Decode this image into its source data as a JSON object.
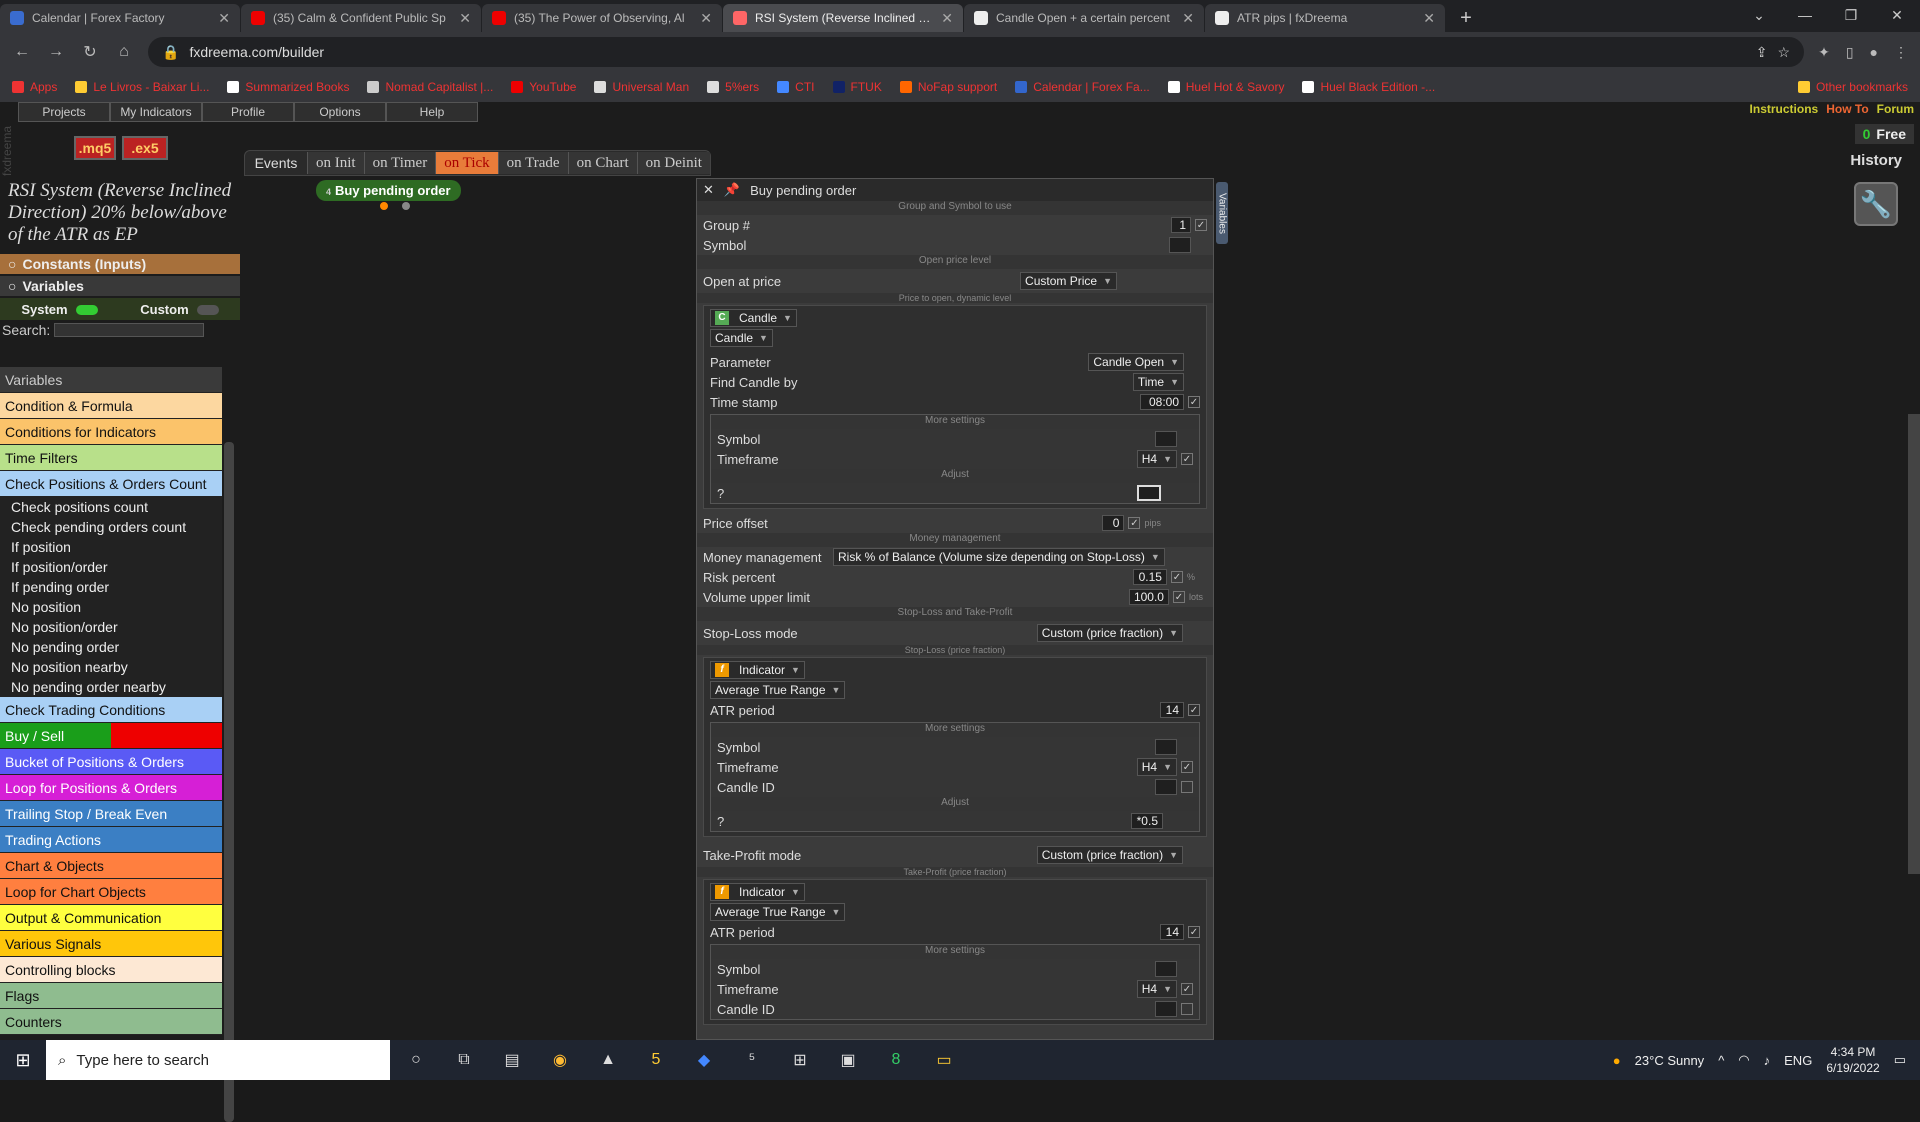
{
  "tabs": [
    {
      "title": "Calendar | Forex Factory",
      "color": "#3a6ccf",
      "active": false
    },
    {
      "title": "(35) Calm & Confident Public Sp",
      "color": "#e00",
      "active": false
    },
    {
      "title": "(35) The Power of Observing, Al",
      "color": "#e00",
      "active": false
    },
    {
      "title": "RSI System (Reverse Inclined Dir",
      "color": "#f66",
      "active": true
    },
    {
      "title": "Candle Open + a certain percent",
      "color": "#eee",
      "active": false
    },
    {
      "title": "ATR pips | fxDreema",
      "color": "#eee",
      "active": false
    }
  ],
  "address": {
    "url": "fxdreema.com/builder"
  },
  "bookmarks": [
    {
      "label": "Apps",
      "color": "#e33"
    },
    {
      "label": "Le Livros - Baixar Li...",
      "color": "#fc3"
    },
    {
      "label": "Summarized Books",
      "color": "#fff"
    },
    {
      "label": "Nomad Capitalist |...",
      "color": "#ccc"
    },
    {
      "label": "YouTube",
      "color": "#e00"
    },
    {
      "label": "Universal Man",
      "color": "#ddd"
    },
    {
      "label": "5%ers",
      "color": "#ddd"
    },
    {
      "label": "CTI",
      "color": "#48f"
    },
    {
      "label": "FTUK",
      "color": "#126"
    },
    {
      "label": "NoFap support",
      "color": "#f60"
    },
    {
      "label": "Calendar | Forex Fa...",
      "color": "#36c"
    },
    {
      "label": "Huel Hot & Savory",
      "color": "#fff"
    },
    {
      "label": "Huel Black Edition -...",
      "color": "#fff"
    }
  ],
  "other_bookmarks": "Other bookmarks",
  "app": {
    "logo_vertical": "fxdreema",
    "menu": [
      "Projects",
      "My Indicators",
      "Profile",
      "Options",
      "Help"
    ],
    "links": {
      "instructions": "Instructions",
      "howto": "How To",
      "forum": "Forum"
    },
    "free_count": "0",
    "free_label": "Free",
    "history": "History",
    "mq5": ".mq5",
    "ex5": ".ex5",
    "events_label": "Events",
    "events": [
      "on Init",
      "on Timer",
      "on Tick",
      "on Trade",
      "on Chart",
      "on Deinit"
    ],
    "active_event": 2,
    "project_title": "RSI System (Reverse Inclined Direction) 20% below/above of the ATR as EP",
    "constants": "Constants (Inputs)",
    "variables_head": "Variables",
    "system": "System",
    "custom": "Custom",
    "search_label": "Search:",
    "categories": [
      {
        "label": "Variables",
        "bg": "#3a3a3a",
        "fg": "#ccc"
      },
      {
        "label": "Condition & Formula",
        "bg": "#fcd7a0",
        "fg": "#111"
      },
      {
        "label": "Conditions for Indicators",
        "bg": "#fbc36a",
        "fg": "#111"
      },
      {
        "label": "Time Filters",
        "bg": "#b8e08a",
        "fg": "#111"
      },
      {
        "label": "Check Positions & Orders Count",
        "bg": "#a9d0f5",
        "fg": "#111"
      }
    ],
    "sub_items": [
      "Check positions count",
      "Check pending orders count",
      "If position",
      "If position/order",
      "If pending order",
      "No position",
      "No position/order",
      "No pending order",
      "No position nearby",
      "No pending order nearby"
    ],
    "categories2": [
      {
        "label": "Check Trading Conditions",
        "bg": "#a9d0f5",
        "fg": "#111"
      },
      {
        "label": "Buy / Sell",
        "bg": "#1a9e1a",
        "fg": "#fff"
      },
      {
        "label": "Bucket of Positions & Orders",
        "bg": "#5a5af5",
        "fg": "#fff"
      },
      {
        "label": "Loop for Positions & Orders",
        "bg": "#d61fd6",
        "fg": "#fff"
      },
      {
        "label": "Trailing Stop / Break Even",
        "bg": "#3b7fc4",
        "fg": "#fff"
      },
      {
        "label": "Trading Actions",
        "bg": "#3b7fc4",
        "fg": "#fff"
      },
      {
        "label": "Chart & Objects",
        "bg": "#ff7f3f",
        "fg": "#111"
      },
      {
        "label": "Loop for Chart Objects",
        "bg": "#ff7f3f",
        "fg": "#111"
      },
      {
        "label": "Output & Communication",
        "bg": "#ffff3f",
        "fg": "#111"
      },
      {
        "label": "Various Signals",
        "bg": "#ffc60a",
        "fg": "#111"
      },
      {
        "label": "Controlling blocks",
        "bg": "#fde8d4",
        "fg": "#111"
      },
      {
        "label": "Flags",
        "bg": "#8fbc8f",
        "fg": "#111"
      },
      {
        "label": "Counters",
        "bg": "#8fbc8f",
        "fg": "#111"
      }
    ],
    "block": {
      "num": "4",
      "label": "Buy pending order"
    },
    "panel": {
      "title": "Buy pending order",
      "sec_group": "Group and Symbol to use",
      "group_label": "Group #",
      "group_val": "1",
      "symbol_label": "Symbol",
      "sec_open": "Open price level",
      "open_label": "Open at price",
      "open_val": "Custom Price",
      "open_hint": "Price to open, dynamic level",
      "candle_type": "Candle",
      "candle_sub": "Candle",
      "param_label": "Parameter",
      "param_val": "Candle Open",
      "find_label": "Find Candle by",
      "find_val": "Time",
      "ts_label": "Time stamp",
      "ts_val": "08:00",
      "more": "More settings",
      "symbol": "Symbol",
      "timeframe": "Timeframe",
      "tf_val": "H4",
      "adjust": "Adjust",
      "q": "?",
      "offset_label": "Price offset",
      "offset_val": "0",
      "pips": "pips",
      "sec_money": "Money management",
      "mm_label": "Money management",
      "mm_val": "Risk % of Balance (Volume size depending on Stop-Loss)",
      "risk_label": "Risk percent",
      "risk_val": "0.15",
      "pct": "%",
      "vol_label": "Volume upper limit",
      "vol_val": "100.0",
      "lots": "lots",
      "sec_sltp": "Stop-Loss and Take-Profit",
      "sl_label": "Stop-Loss mode",
      "sl_val": "Custom (price fraction)",
      "sl_hint": "Stop-Loss (price fraction)",
      "ind_label": "Indicator",
      "atr": "Average True Range",
      "atr_period": "ATR period",
      "atr_val": "14",
      "candle_id": "Candle ID",
      "adj_val": "*0.5",
      "tp_label": "Take-Profit mode",
      "tp_val": "Custom (price fraction)",
      "tp_hint": "Take-Profit (price fraction)"
    },
    "vars_tab": "Variables"
  },
  "taskbar": {
    "search": "Type here to search",
    "weather": "23°C  Sunny",
    "lang": "ENG",
    "time": "4:34 PM",
    "date": "6/19/2022"
  }
}
